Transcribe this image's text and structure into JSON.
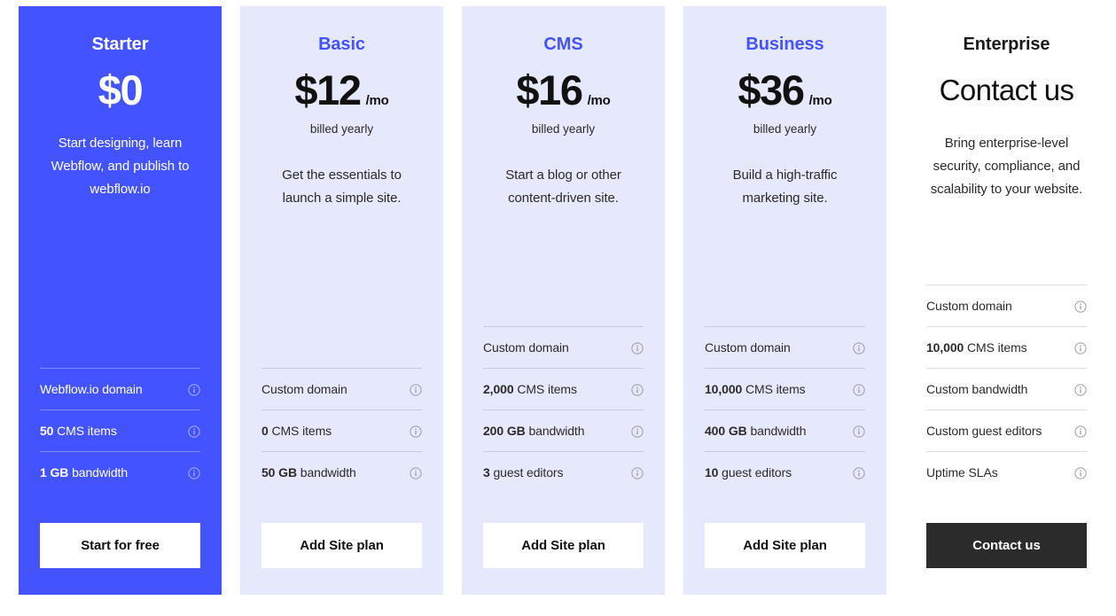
{
  "accent_color": "#4353FF",
  "card_light_color": "#E6E8FB",
  "dark_button_color": "#2B2B2B",
  "info_icon": "info-circle-icon",
  "plans": [
    {
      "name": "Starter",
      "price": "$0",
      "period": "",
      "billing": "",
      "description": "Start designing, learn Webflow, and publish to webflow.io",
      "theme": "featured",
      "features": [
        {
          "qty": "",
          "label": "Webflow.io domain"
        },
        {
          "qty": "50",
          "label": "CMS items"
        },
        {
          "qty": "1 GB",
          "label": "bandwidth"
        }
      ],
      "cta": "Start for free",
      "cta_style": "light"
    },
    {
      "name": "Basic",
      "price": "$12",
      "period": "/mo",
      "billing": "billed yearly",
      "description": "Get the essentials to launch a simple site.",
      "theme": "light",
      "features": [
        {
          "qty": "",
          "label": "Custom domain"
        },
        {
          "qty": "0",
          "label": "CMS items"
        },
        {
          "qty": "50 GB",
          "label": "bandwidth"
        }
      ],
      "cta": "Add Site plan",
      "cta_style": "light"
    },
    {
      "name": "CMS",
      "price": "$16",
      "period": "/mo",
      "billing": "billed yearly",
      "description": "Start a blog or other content-driven site.",
      "theme": "light",
      "features": [
        {
          "qty": "",
          "label": "Custom domain"
        },
        {
          "qty": "2,000",
          "label": "CMS items"
        },
        {
          "qty": "200 GB",
          "label": "bandwidth"
        },
        {
          "qty": "3",
          "label": "guest editors"
        }
      ],
      "cta": "Add Site plan",
      "cta_style": "light"
    },
    {
      "name": "Business",
      "price": "$36",
      "period": "/mo",
      "billing": "billed yearly",
      "description": "Build a high-traffic marketing site.",
      "theme": "light",
      "features": [
        {
          "qty": "",
          "label": "Custom domain"
        },
        {
          "qty": "10,000",
          "label": "CMS items"
        },
        {
          "qty": "400 GB",
          "label": "bandwidth"
        },
        {
          "qty": "10",
          "label": "guest editors"
        }
      ],
      "cta": "Add Site plan",
      "cta_style": "light"
    },
    {
      "name": "Enterprise",
      "price": "Contact us",
      "period": "",
      "billing": "",
      "description": "Bring enterprise-level security, compliance, and scalability to your website.",
      "theme": "plain",
      "features": [
        {
          "qty": "",
          "label": "Custom domain"
        },
        {
          "qty": "10,000",
          "label": "CMS items"
        },
        {
          "qty": "",
          "label": "Custom bandwidth"
        },
        {
          "qty": "",
          "label": "Custom guest editors"
        },
        {
          "qty": "",
          "label": "Uptime SLAs"
        }
      ],
      "cta": "Contact us",
      "cta_style": "dark"
    }
  ]
}
